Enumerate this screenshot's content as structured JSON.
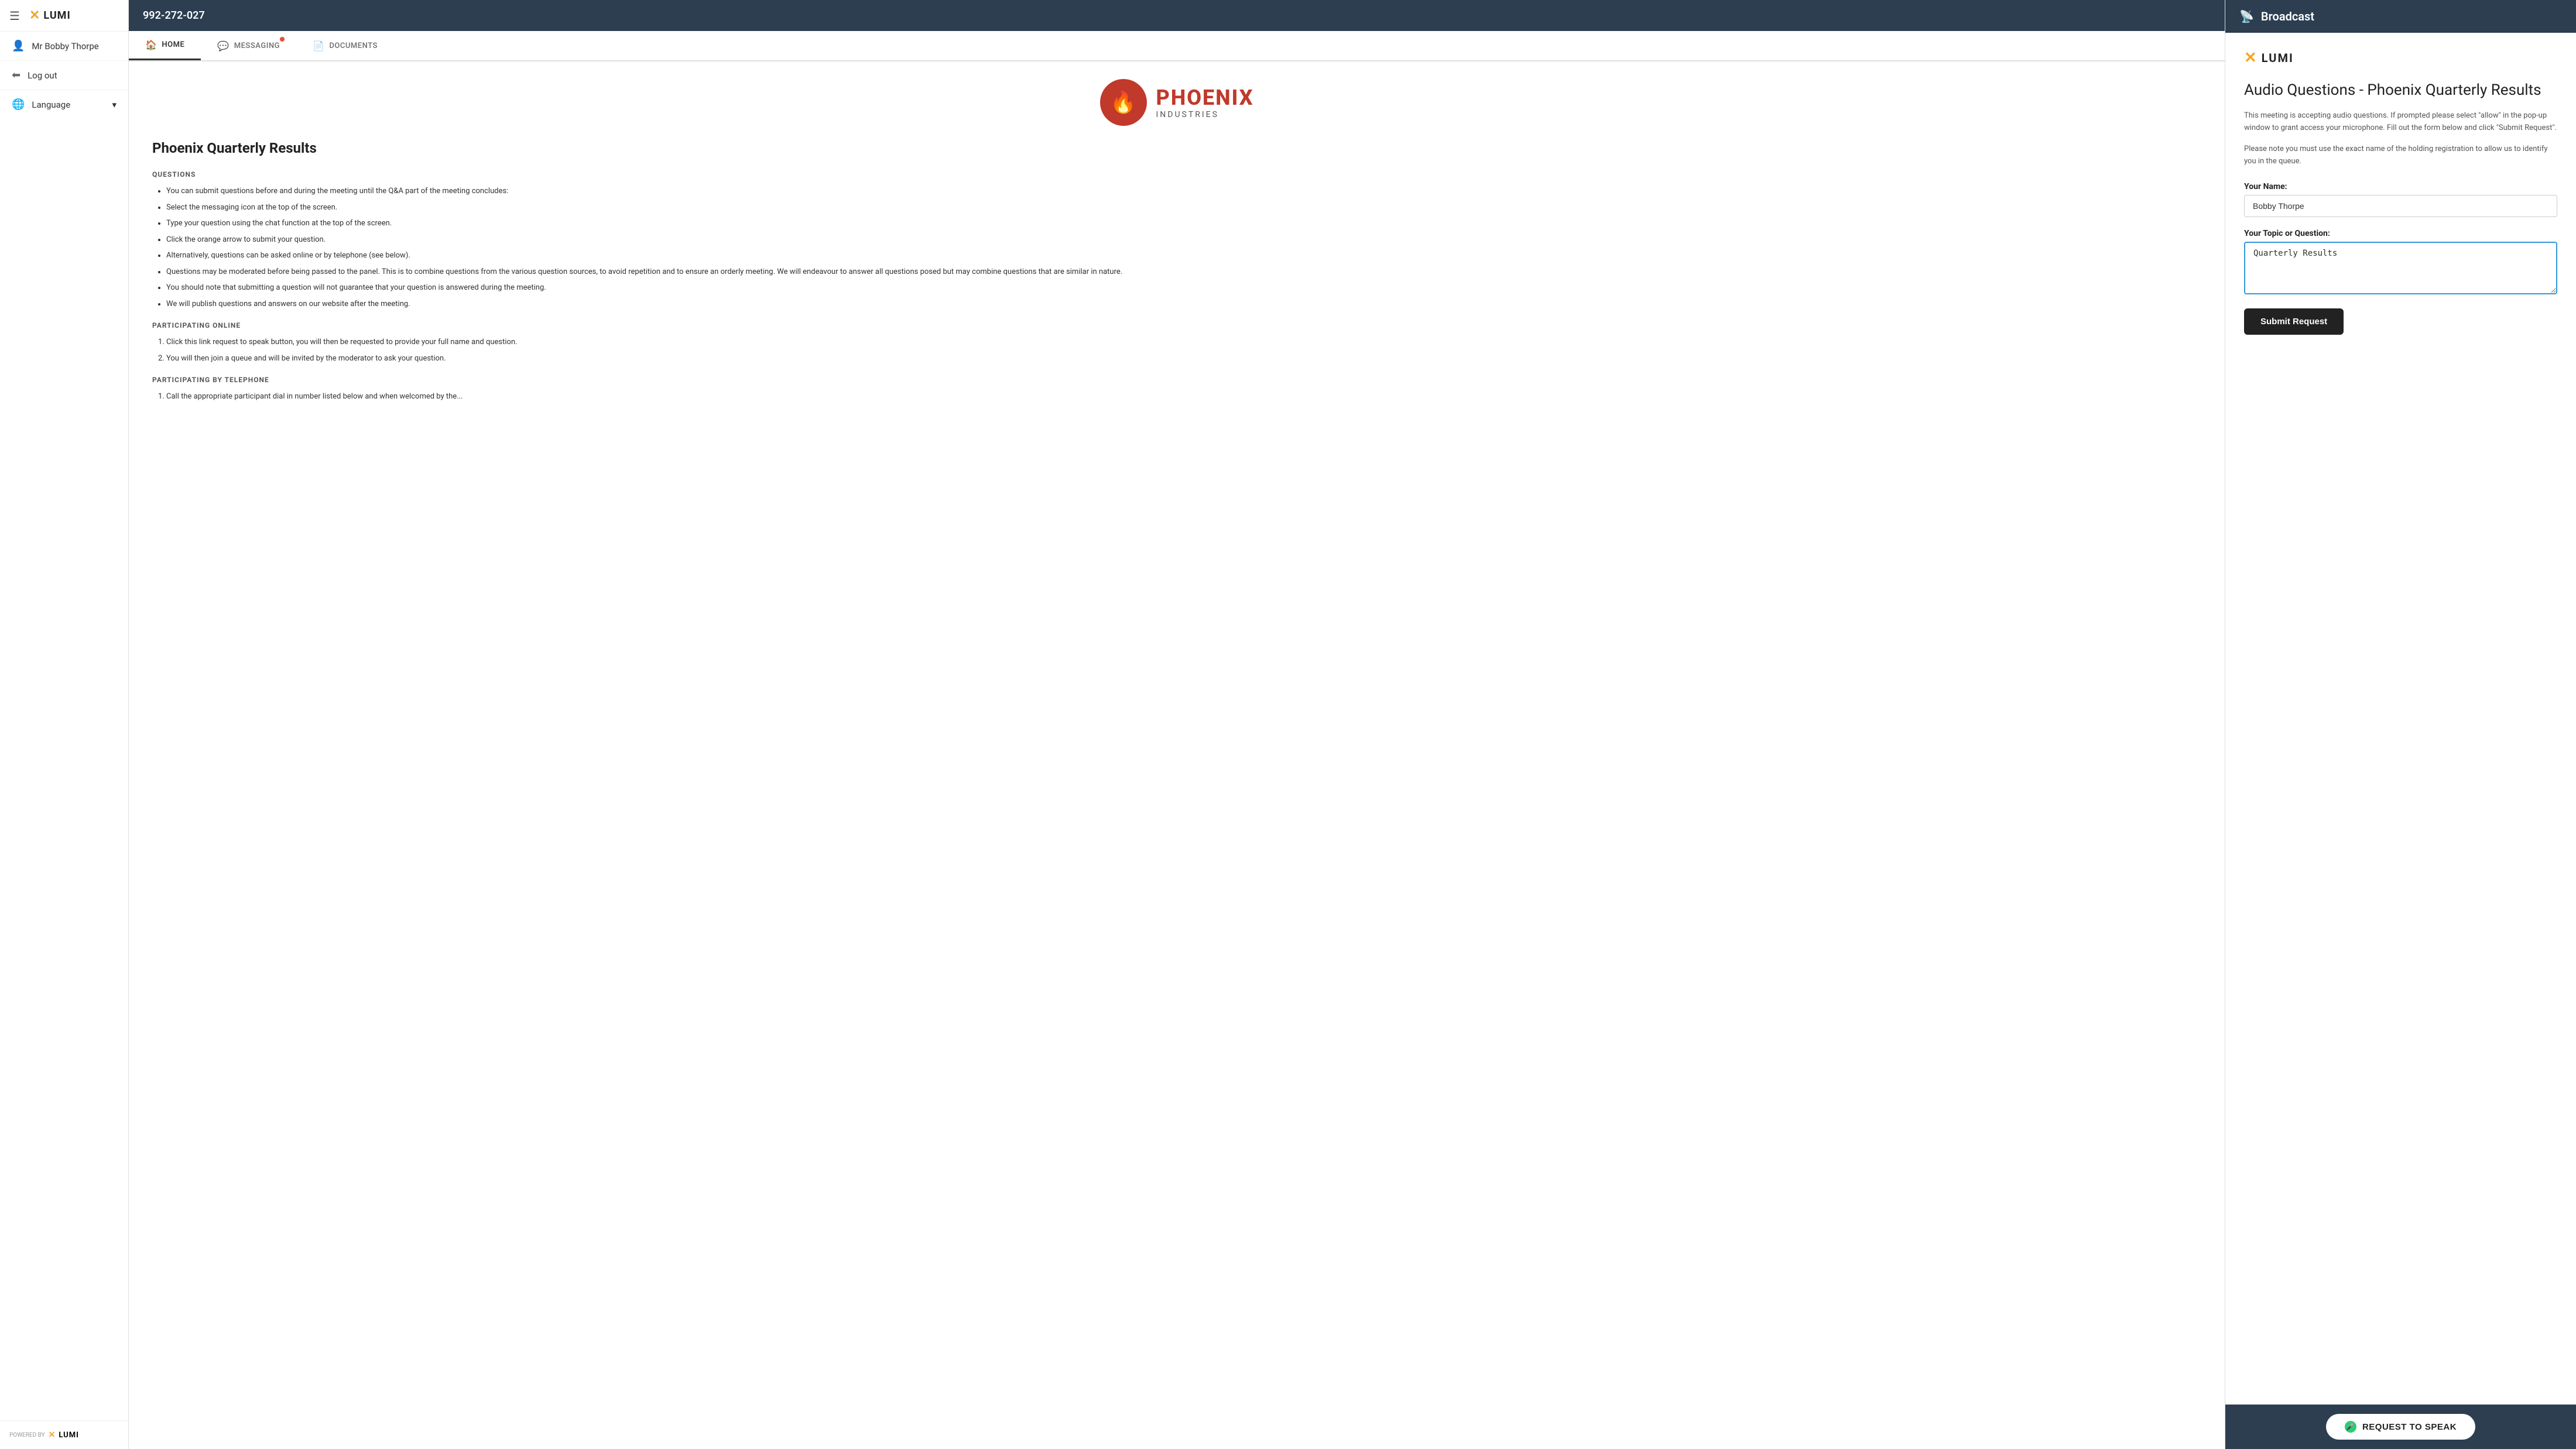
{
  "sidebar": {
    "hamburger_icon": "☰",
    "logo_x": "✕",
    "logo_text": "LUMI",
    "user": {
      "icon": "👤",
      "name": "Mr Bobby Thorpe"
    },
    "logout": {
      "icon": "⬅",
      "label": "Log out"
    },
    "language": {
      "icon": "🌐",
      "label": "Language",
      "chevron": "▾"
    },
    "powered_by": "POWERED BY",
    "footer_logo_x": "✕",
    "footer_logo_text": "LUMI"
  },
  "meeting": {
    "session_id": "992-272-027",
    "tabs": [
      {
        "id": "home",
        "icon": "🏠",
        "label": "HOME",
        "active": true,
        "has_dot": false
      },
      {
        "id": "messaging",
        "icon": "💬",
        "label": "MESSAGING",
        "active": false,
        "has_dot": true
      },
      {
        "id": "documents",
        "icon": "📄",
        "label": "DOCUMENTS",
        "active": false,
        "has_dot": false
      }
    ],
    "phoenix_logo_symbol": "🔥",
    "phoenix_main": "PHOENIX",
    "phoenix_sub": "INDUSTRIES",
    "page_title": "Phoenix Quarterly Results",
    "sections": [
      {
        "heading": "QUESTIONS",
        "type": "bullets",
        "items": [
          "You can submit questions before and during the meeting until the Q&A part of the meeting concludes:",
          "Select the messaging icon at the top of the screen.",
          "Type your question using the chat function at the top of the screen.",
          "Click the orange arrow to submit your question.",
          "Alternatively, questions can be asked online or by telephone (see below).",
          "Questions may be moderated before being passed to the panel. This is to combine questions from the various question sources, to avoid repetition and to ensure an orderly meeting. We will endeavour to answer all questions posed but may combine questions that are similar in nature.",
          "You should note that submitting a question will not guarantee that your question is answered during the meeting.",
          "We will publish questions and answers on our website after the meeting."
        ]
      },
      {
        "heading": "PARTICIPATING ONLINE",
        "type": "ordered",
        "items": [
          "Click this link request to speak button, you will then be requested to provide your full name and question.",
          "You will then join a queue and will be invited by the moderator to ask your question."
        ]
      },
      {
        "heading": "PARTICIPATING BY TELEPHONE",
        "type": "ordered",
        "items": [
          "Call the appropriate participant dial in number listed below and when welcomed by the..."
        ]
      }
    ]
  },
  "broadcast": {
    "header_icon": "📡",
    "header_title": "Broadcast",
    "logo_x": "✕",
    "logo_text": "LUMI",
    "form_title": "Audio Questions - Phoenix Quarterly Results",
    "description": "This meeting is accepting audio questions. If prompted please select \"allow\" in the pop-up window to grant access your microphone. Fill out the form below and click \"Submit Request\".",
    "note": "Please note you must use the exact name of the holding registration to allow us to identify you in the queue.",
    "name_label": "Your Name:",
    "name_value": "Bobby Thorpe",
    "name_placeholder": "Bobby Thorpe",
    "topic_label": "Your Topic or Question:",
    "topic_value": "Quarterly Results",
    "topic_placeholder": "Quarterly Results",
    "submit_label": "Submit Request",
    "footer": {
      "mic_icon": "🎤",
      "request_label": "REQUEST TO SPEAK"
    }
  }
}
